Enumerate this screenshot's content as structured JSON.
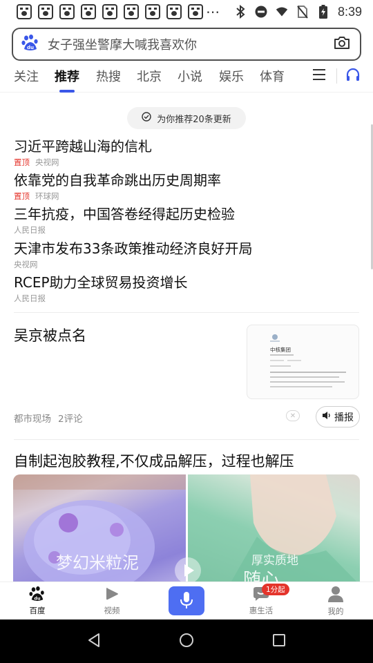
{
  "status_bar": {
    "time": "8:39",
    "overflow": "⋯",
    "notification_icons": [
      "baidu-paw-icon",
      "baidu-paw-icon",
      "baidu-paw-icon",
      "baidu-paw-icon",
      "baidu-paw-icon",
      "baidu-paw-icon",
      "baidu-paw-icon",
      "baidu-paw-icon",
      "baidu-paw-icon"
    ]
  },
  "search": {
    "placeholder": "女子强坐警摩大喊我喜欢你"
  },
  "tabs": [
    {
      "label": "关注",
      "active": false
    },
    {
      "label": "推荐",
      "active": true
    },
    {
      "label": "热搜",
      "active": false
    },
    {
      "label": "北京",
      "active": false
    },
    {
      "label": "小说",
      "active": false
    },
    {
      "label": "娱乐",
      "active": false
    },
    {
      "label": "体育",
      "active": false
    }
  ],
  "refresh": {
    "label": "为你推荐20条更新"
  },
  "headlines": [
    {
      "title": "习近平跨越山海的信札",
      "pinned": "置顶",
      "source": "央视网"
    },
    {
      "title": "依靠党的自我革命跳出历史周期率",
      "pinned": "置顶",
      "source": "环球网"
    },
    {
      "title": "三年抗疫，中国答卷经得起历史检验",
      "pinned": "",
      "source": "人民日报"
    },
    {
      "title": "天津市发布33条政策推动经济良好开局",
      "pinned": "",
      "source": "央视网"
    },
    {
      "title": "RCEP助力全球贸易投资增长",
      "pinned": "",
      "source": "人民日报"
    }
  ],
  "article": {
    "title": "吴京被点名",
    "source": "都市现场",
    "comments": "2评论",
    "play_label": "播报",
    "thumb_heading": "中核集团"
  },
  "video_card": {
    "title": "自制起泡胶教程,不仅成品解压，过程也解压",
    "left_caption": "梦幻米粒泥",
    "right_caption_1": "厚实质地",
    "right_caption_2": "随心"
  },
  "bottom_nav": [
    {
      "label": "百度",
      "icon": "baidu-paw-icon",
      "active": true
    },
    {
      "label": "视频",
      "icon": "video-play-icon",
      "active": false
    },
    {
      "label": "",
      "icon": "microphone-icon",
      "active": false
    },
    {
      "label": "惠生活",
      "icon": "chat-bubble-icon",
      "active": false,
      "badge": "1分起"
    },
    {
      "label": "我的",
      "icon": "user-icon",
      "active": false
    }
  ],
  "colors": {
    "accent": "#4e6ef2",
    "pinned": "#e4342b",
    "tab_indicator": "#3a57e8"
  }
}
